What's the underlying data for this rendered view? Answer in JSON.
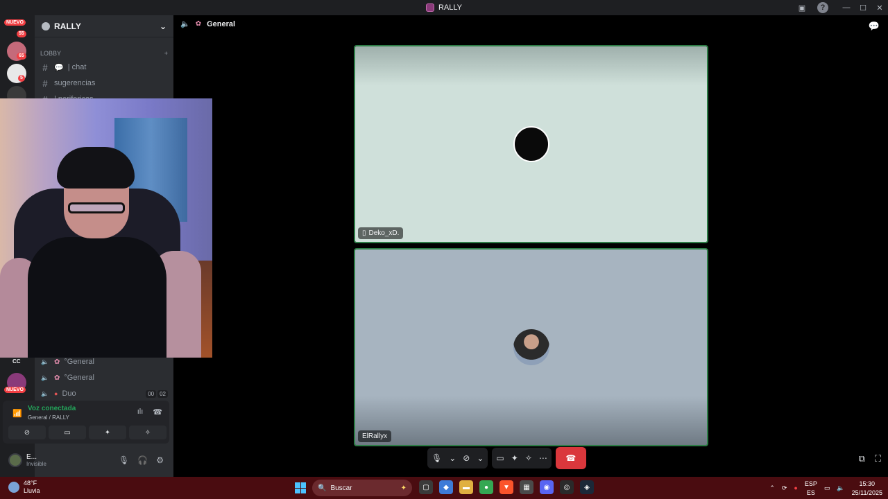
{
  "window": {
    "title": "RALLY",
    "controls": [
      "minimize",
      "maximize",
      "close"
    ]
  },
  "rail": {
    "badges": [
      "55",
      "65",
      "5"
    ],
    "new_label": "NUEVO",
    "cc_label": "CC"
  },
  "server": {
    "name": "RALLY"
  },
  "category": {
    "name": "LOBBY"
  },
  "channels": [
    {
      "name": "| chat"
    },
    {
      "name": "sugerencias"
    },
    {
      "name": "| perifericos"
    }
  ],
  "voice_channels": [
    {
      "name": "°General"
    },
    {
      "name": "°General"
    },
    {
      "name": "Duo",
      "counters": [
        "00",
        "02"
      ]
    }
  ],
  "voice_panel": {
    "status": "Voz conectada",
    "location": "General / RALLY"
  },
  "user": {
    "name": "E...",
    "status": "Invisible"
  },
  "stage": {
    "channel": "General"
  },
  "participants": [
    {
      "name": "Deko_xD.",
      "device": "mobile"
    },
    {
      "name": "ElRallyx"
    }
  ],
  "taskbar": {
    "weather_temp": "48°F",
    "weather_desc": "Lluvia",
    "search_placeholder": "Buscar",
    "lang": "ESP",
    "lang_sub": "ES",
    "time": "15:30",
    "date": "25/11/2025"
  },
  "colors": {
    "accent_green": "#23a55a",
    "hangup_red": "#da373c",
    "taskbar": "#4a0c10"
  }
}
